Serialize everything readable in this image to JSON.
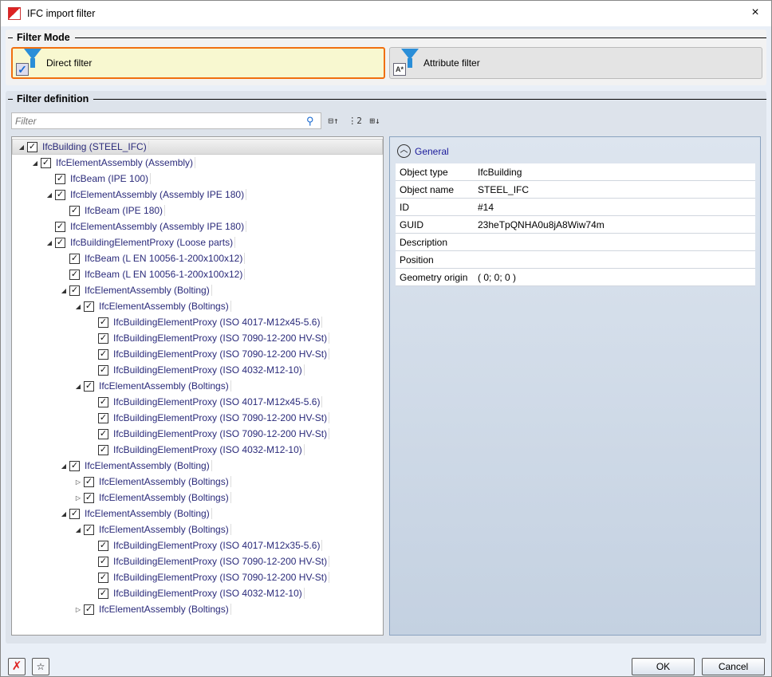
{
  "window": {
    "title": "IFC import filter",
    "close_icon": "×"
  },
  "filter_mode": {
    "title": "Filter Mode",
    "direct": "Direct filter",
    "attribute": "Attribute filter",
    "selected": "Direct filter"
  },
  "filter_definition": {
    "title": "Filter definition",
    "search_placeholder": "Filter",
    "search_value": ""
  },
  "tree": [
    {
      "label": "IfcBuilding (STEEL_IFC)",
      "depth": 0,
      "state": "expanded",
      "checked": true,
      "selected": true
    },
    {
      "label": "IfcElementAssembly (Assembly)",
      "depth": 1,
      "state": "expanded",
      "checked": true
    },
    {
      "label": "IfcBeam (IPE 100)",
      "depth": 2,
      "state": "leaf",
      "checked": true
    },
    {
      "label": "IfcElementAssembly (Assembly IPE 180)",
      "depth": 2,
      "state": "expanded",
      "checked": true
    },
    {
      "label": "IfcBeam (IPE 180)",
      "depth": 3,
      "state": "leaf",
      "checked": true
    },
    {
      "label": "IfcElementAssembly (Assembly IPE 180)",
      "depth": 2,
      "state": "leaf",
      "checked": true
    },
    {
      "label": "IfcBuildingElementProxy (Loose parts)",
      "depth": 2,
      "state": "expanded",
      "checked": true
    },
    {
      "label": "IfcBeam (L EN 10056-1-200x100x12)",
      "depth": 3,
      "state": "leaf",
      "checked": true
    },
    {
      "label": "IfcBeam (L EN 10056-1-200x100x12)",
      "depth": 3,
      "state": "leaf",
      "checked": true
    },
    {
      "label": "IfcElementAssembly (Bolting)",
      "depth": 3,
      "state": "expanded",
      "checked": true
    },
    {
      "label": "IfcElementAssembly (Boltings)",
      "depth": 4,
      "state": "expanded",
      "checked": true
    },
    {
      "label": "IfcBuildingElementProxy (ISO 4017-M12x45-5.6)",
      "depth": 5,
      "state": "leaf",
      "checked": true
    },
    {
      "label": "IfcBuildingElementProxy (ISO 7090-12-200 HV-St)",
      "depth": 5,
      "state": "leaf",
      "checked": true
    },
    {
      "label": "IfcBuildingElementProxy (ISO 7090-12-200 HV-St)",
      "depth": 5,
      "state": "leaf",
      "checked": true
    },
    {
      "label": "IfcBuildingElementProxy (ISO 4032-M12-10)",
      "depth": 5,
      "state": "leaf",
      "checked": true
    },
    {
      "label": "IfcElementAssembly (Boltings)",
      "depth": 4,
      "state": "expanded",
      "checked": true
    },
    {
      "label": "IfcBuildingElementProxy (ISO 4017-M12x45-5.6)",
      "depth": 5,
      "state": "leaf",
      "checked": true
    },
    {
      "label": "IfcBuildingElementProxy (ISO 7090-12-200 HV-St)",
      "depth": 5,
      "state": "leaf",
      "checked": true
    },
    {
      "label": "IfcBuildingElementProxy (ISO 7090-12-200 HV-St)",
      "depth": 5,
      "state": "leaf",
      "checked": true
    },
    {
      "label": "IfcBuildingElementProxy (ISO 4032-M12-10)",
      "depth": 5,
      "state": "leaf",
      "checked": true
    },
    {
      "label": "IfcElementAssembly (Bolting)",
      "depth": 3,
      "state": "expanded",
      "checked": true
    },
    {
      "label": "IfcElementAssembly (Boltings)",
      "depth": 4,
      "state": "collapsed",
      "checked": true
    },
    {
      "label": "IfcElementAssembly (Boltings)",
      "depth": 4,
      "state": "collapsed",
      "checked": true
    },
    {
      "label": "IfcElementAssembly (Bolting)",
      "depth": 3,
      "state": "expanded",
      "checked": true
    },
    {
      "label": "IfcElementAssembly (Boltings)",
      "depth": 4,
      "state": "expanded",
      "checked": true
    },
    {
      "label": "IfcBuildingElementProxy (ISO 4017-M12x35-5.6)",
      "depth": 5,
      "state": "leaf",
      "checked": true
    },
    {
      "label": "IfcBuildingElementProxy (ISO 7090-12-200 HV-St)",
      "depth": 5,
      "state": "leaf",
      "checked": true
    },
    {
      "label": "IfcBuildingElementProxy (ISO 7090-12-200 HV-St)",
      "depth": 5,
      "state": "leaf",
      "checked": true
    },
    {
      "label": "IfcBuildingElementProxy (ISO 4032-M12-10)",
      "depth": 5,
      "state": "leaf",
      "checked": true
    },
    {
      "label": "IfcElementAssembly (Boltings)",
      "depth": 4,
      "state": "collapsed",
      "checked": true
    }
  ],
  "properties": {
    "section": "General",
    "rows": [
      {
        "key": "Object type",
        "value": "IfcBuilding"
      },
      {
        "key": "Object name",
        "value": "STEEL_IFC"
      },
      {
        "key": "ID",
        "value": "#14"
      },
      {
        "key": "GUID",
        "value": "23heTpQNHA0u8jA8Wiw74m"
      },
      {
        "key": "Description",
        "value": ""
      },
      {
        "key": "Position",
        "value": ""
      },
      {
        "key": "Geometry origin",
        "value": "( 0; 0; 0 )"
      }
    ]
  },
  "footer": {
    "ok": "OK",
    "cancel": "Cancel"
  }
}
